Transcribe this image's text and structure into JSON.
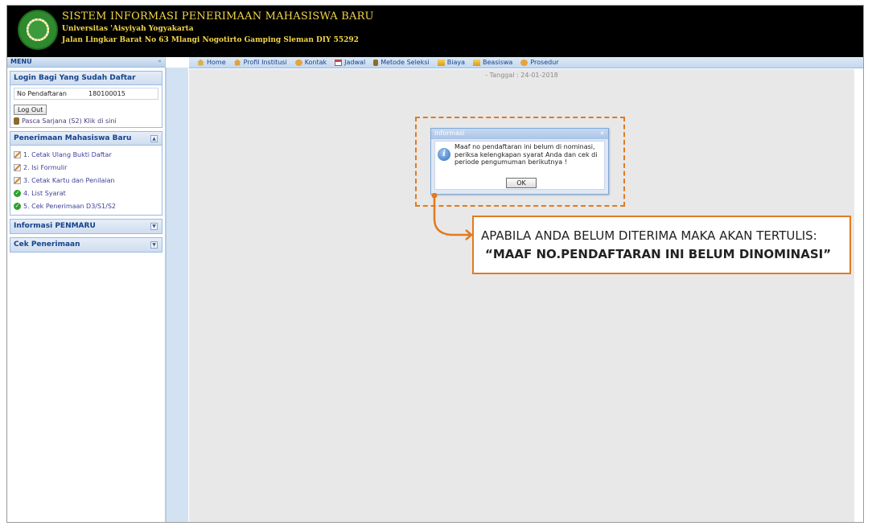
{
  "header": {
    "title": "SISTEM INFORMASI PENERIMAAN MAHASISWA BARU",
    "university": "Universitas 'Aisyiyah Yogyakarta",
    "address": "Jalan Lingkar Barat No 63 Mlangi Nogotirto Gamping Sleman DIY 55292"
  },
  "sidebar": {
    "menu_title": "MENU",
    "login_panel": {
      "title": "Login Bagi Yang Sudah Daftar",
      "field_label": "No Pendaftaran",
      "field_value": "180100015",
      "logout_label": "Log Out",
      "pasca_link": "Pasca Sarjana (S2) Klik di sini"
    },
    "pmb_panel": {
      "title": "Penerimaan Mahasiswa Baru",
      "items": [
        {
          "label": "1. Cetak Ulang Bukti Daftar",
          "icon": "edit-icon"
        },
        {
          "label": "2. Isi Formulir",
          "icon": "edit-icon"
        },
        {
          "label": "3. Cetak Kartu dan Penilaian",
          "icon": "edit-icon"
        },
        {
          "label": "4. List Syarat",
          "icon": "check-icon"
        },
        {
          "label": "5. Cek Penerimaan D3/S1/S2",
          "icon": "check-icon"
        }
      ]
    },
    "info_panel": {
      "title": "Informasi PENMARU"
    },
    "cek_panel": {
      "title": "Cek Penerimaan"
    }
  },
  "navbar": {
    "items": [
      "Home",
      "Profil Institusi",
      "Kontak",
      "Jadwal",
      "Metode Seleksi",
      "Biaya",
      "Beasiswa",
      "Prosedur"
    ]
  },
  "content": {
    "date_line": "- Tanggal : 24-01-2018"
  },
  "dialog": {
    "title": "Informasi",
    "message": "Maaf no pendaftaran ini belum di nominasi, periksa kelengkapan syarat Anda dan cek di periode pengumuman berikutnya !",
    "ok_label": "OK"
  },
  "callout": {
    "line1": "APABILA ANDA BELUM DITERIMA MAKA AKAN TERTULIS:",
    "line2": "“MAAF NO.PENDAFTARAN INI BELUM DINOMINASI”"
  },
  "colors": {
    "header_bg": "#000000",
    "header_text": "#f3d64a",
    "highlight": "#e07b22",
    "panel_title": "#15428b"
  }
}
